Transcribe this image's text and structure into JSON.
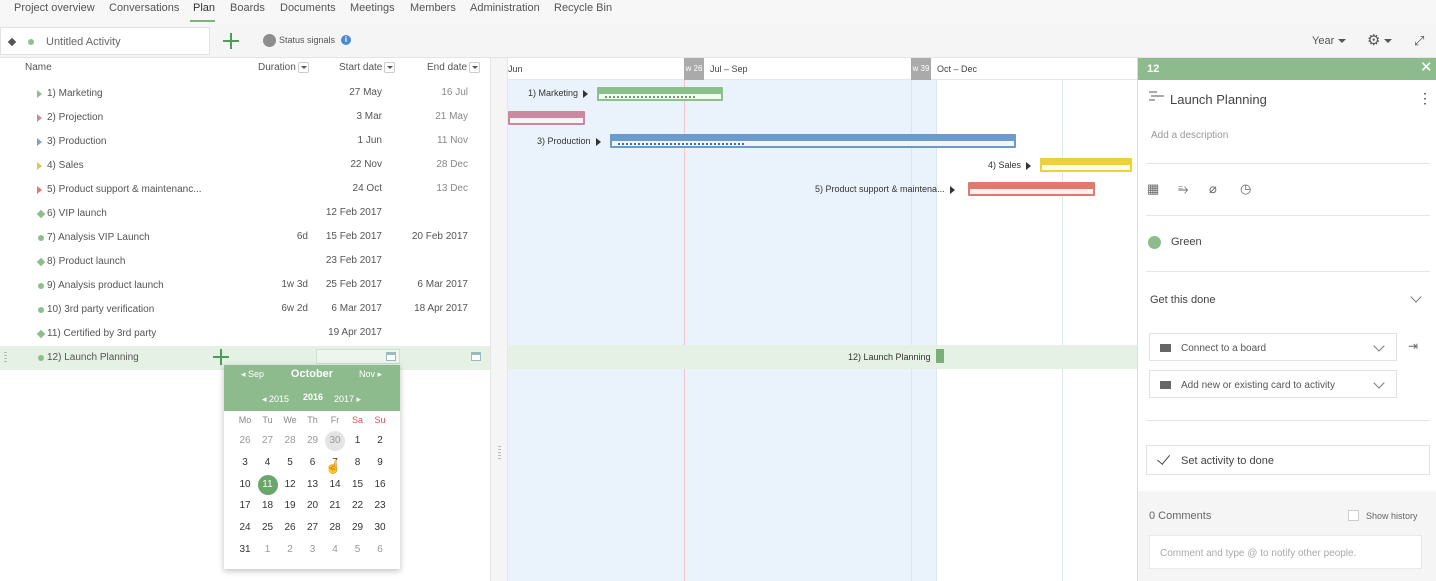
{
  "nav": {
    "tabs": [
      {
        "label": "Project overview"
      },
      {
        "label": "Conversations"
      },
      {
        "label": "Plan"
      },
      {
        "label": "Boards"
      },
      {
        "label": "Documents"
      },
      {
        "label": "Meetings"
      },
      {
        "label": "Members"
      },
      {
        "label": "Administration"
      },
      {
        "label": "Recycle Bin"
      }
    ],
    "active": "Plan"
  },
  "toolbar": {
    "activity_title": "Untitled Activity",
    "status_signals": "Status signals",
    "info_glyph": "i",
    "zoom": "Year",
    "gear_glyph": "⚙",
    "expand_glyph": "⤢",
    "add_icon": "plus-icon"
  },
  "table": {
    "headers": {
      "name": "Name",
      "duration": "Duration",
      "start": "Start date",
      "end": "End date"
    },
    "rows": [
      {
        "name": "1)  Marketing",
        "duration": "",
        "start": "27 May",
        "end": "16 Jul",
        "marker": "triangle",
        "color": "#8bbf8b"
      },
      {
        "name": "2)  Projection",
        "duration": "",
        "start": "3 Mar",
        "end": "21 May",
        "marker": "triangle",
        "color": "#c98aa0"
      },
      {
        "name": "3)  Production",
        "duration": "",
        "start": "1 Jun",
        "end": "11 Nov",
        "marker": "triangle",
        "color": "#7aa3cc"
      },
      {
        "name": "4)  Sales",
        "duration": "",
        "start": "22 Nov",
        "end": "28 Dec",
        "marker": "triangle",
        "color": "#e8c440"
      },
      {
        "name": "5)  Product support & maintenanc...",
        "duration": "",
        "start": "24 Oct",
        "end": "13 Dec",
        "marker": "triangle",
        "color": "#e07a6a"
      },
      {
        "name": "6)  VIP launch",
        "duration": "",
        "start": "12 Feb 2017",
        "end": "",
        "marker": "diamond",
        "color": "#8bbf8b"
      },
      {
        "name": "7)  Analysis VIP Launch",
        "duration": "6d",
        "start": "15 Feb 2017",
        "end": "20 Feb 2017",
        "marker": "dot",
        "color": "#8bbf8b"
      },
      {
        "name": "8)  Product launch",
        "duration": "",
        "start": "23 Feb 2017",
        "end": "",
        "marker": "diamond",
        "color": "#8bbf8b"
      },
      {
        "name": "9)  Analysis product launch",
        "duration": "1w 3d",
        "start": "25 Feb 2017",
        "end": "6 Mar 2017",
        "marker": "dot",
        "color": "#8bbf8b"
      },
      {
        "name": "10)  3rd party verification",
        "duration": "6w 2d",
        "start": "6 Mar 2017",
        "end": "18 Apr 2017",
        "marker": "dot",
        "color": "#8bbf8b"
      },
      {
        "name": "11)  Certified by 3rd party",
        "duration": "",
        "start": "19 Apr 2017",
        "end": "",
        "marker": "diamond",
        "color": "#8bbf8b"
      },
      {
        "name": "12)  Launch Planning",
        "duration": "",
        "start": "",
        "end": "",
        "marker": "dot",
        "color": "#8bbf8b"
      }
    ]
  },
  "datepicker": {
    "prev_month": "Sep",
    "month": "October",
    "next_month": "Nov",
    "prev_year": "2015",
    "year": "2016",
    "next_year": "2017",
    "weekdays": [
      "Mo",
      "Tu",
      "We",
      "Th",
      "Fr",
      "Sa",
      "Su"
    ],
    "weeks": [
      [
        "26",
        "27",
        "28",
        "29",
        "30",
        "1",
        "2"
      ],
      [
        "3",
        "4",
        "5",
        "6",
        "7",
        "8",
        "9"
      ],
      [
        "10",
        "11",
        "12",
        "13",
        "14",
        "15",
        "16"
      ],
      [
        "17",
        "18",
        "19",
        "20",
        "21",
        "22",
        "23"
      ],
      [
        "24",
        "25",
        "26",
        "27",
        "28",
        "29",
        "30"
      ],
      [
        "31",
        "1",
        "2",
        "3",
        "4",
        "5",
        "6"
      ]
    ],
    "selected_day": "11",
    "highlighted_day": "30"
  },
  "gantt": {
    "periods": [
      "Jun",
      "Jul – Sep",
      "Oct – Dec"
    ],
    "week_markers": [
      "w 26",
      "w 39"
    ],
    "bars": [
      {
        "label": "1)  Marketing",
        "color": "#8bbf8b"
      },
      {
        "label": "",
        "color": "#c98aa0"
      },
      {
        "label": "3)  Production",
        "color": "#6a9bcc"
      },
      {
        "label": "4)  Sales",
        "color": "#ecd040"
      },
      {
        "label": "5)  Product support & maintena...",
        "color": "#e07a6a"
      },
      {
        "label": "12)  Launch Planning",
        "color": "#78b078"
      }
    ]
  },
  "details": {
    "id": "12",
    "close_glyph": "✕",
    "title": "Launch Planning",
    "kebab_glyph": "⋮",
    "description_placeholder": "Add a description",
    "tools": [
      {
        "name": "calendar-icon",
        "glyph": "▦"
      },
      {
        "name": "hierarchy-icon",
        "glyph": "⥱"
      },
      {
        "name": "paperclip-icon",
        "glyph": "⌀"
      },
      {
        "name": "clock-icon",
        "glyph": "◷"
      }
    ],
    "status": "Green",
    "status_color": "#8dbb8d",
    "get_done": "Get this done",
    "connect_board": "Connect to a board",
    "add_card": "Add new or existing card to activity",
    "enter_glyph": "⇥",
    "set_done": "Set activity to done",
    "comments_count": "0 Comments",
    "show_history": "Show history",
    "comment_placeholder": "Comment and type @ to notify other people."
  }
}
